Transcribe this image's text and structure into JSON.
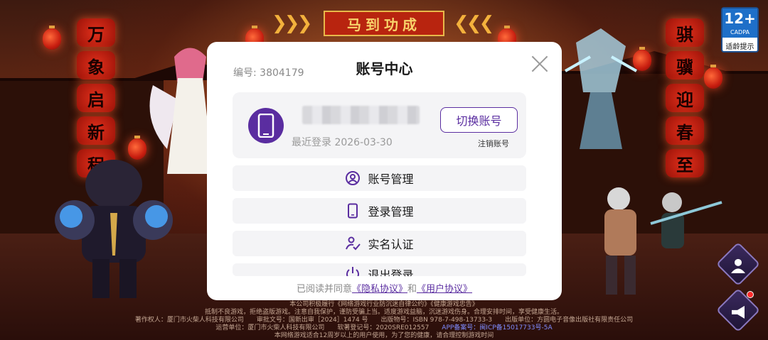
{
  "top_sign": "马到功成",
  "left_banner": [
    "万",
    "象",
    "启",
    "新",
    "程"
  ],
  "right_banner": [
    "骐",
    "骥",
    "迎",
    "春",
    "至"
  ],
  "age_badge": {
    "rating": "12+",
    "org": "CADPA",
    "tip": "适龄提示"
  },
  "modal": {
    "account_label": "编号:",
    "account_number": "3804179",
    "title": "账号中心",
    "last_login_label": "最近登录",
    "last_login_date": "2026-03-30",
    "switch_account": "切换账号",
    "cancel_account": "注销账号",
    "menu": [
      {
        "label": "账号管理",
        "icon": "user-circle-icon"
      },
      {
        "label": "登录管理",
        "icon": "phone-icon"
      },
      {
        "label": "实名认证",
        "icon": "id-check-icon"
      },
      {
        "label": "退出登录",
        "icon": "power-icon"
      }
    ],
    "agree_prefix": "已阅读并同意",
    "privacy": "《隐私协议》",
    "and": "和",
    "user_agreement": "《用户协议》"
  },
  "footer": {
    "line1": "本公司积极履行《网络游戏行业防沉迷自律公约》《健康游戏忠告》",
    "line2": "抵制不良游戏，拒绝盗版游戏。注意自我保护，谨防受骗上当。适度游戏益脑，沉迷游戏伤身。合理安排时间，享受健康生活。",
    "line3": "著作权人：厦门市火柴人科技有限公司　　审批文号：国新出审［2024］1474 号　　出版物号：ISBN 978-7-498-13733-3　　出版单位：方圆电子音像出版社有限责任公司",
    "line4a": "运营单位：厦门市火柴人科技有限公司　　软著登记号：2020SRE012557　　",
    "line4b": "APP备案号：闽ICP备15017733号-5A",
    "line5": "本网络游戏适合12周岁以上的用户使用，为了您的健康，请合理控制游戏时间"
  },
  "colors": {
    "accent": "#5a2da0",
    "modal_bg": "#ffffff",
    "card_bg": "#f4f4f6"
  }
}
